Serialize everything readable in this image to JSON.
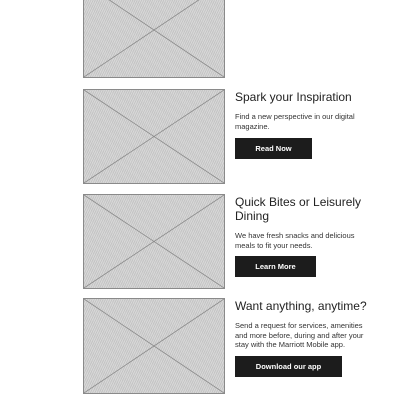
{
  "cards": [
    {
      "title": "",
      "description": "",
      "button_label": "",
      "image_icon": "image-placeholder-icon"
    },
    {
      "title": "Spark your Inspiration",
      "description": "Find a new perspective in our digital magazine.",
      "button_label": "Read Now",
      "image_icon": "image-placeholder-icon"
    },
    {
      "title": "Quick Bites or Leisurely Dining",
      "description": "We have fresh snacks and delicious meals to fit your needs.",
      "button_label": "Learn More",
      "image_icon": "image-placeholder-icon"
    },
    {
      "title": "Want anything, anytime?",
      "description": "Send a request for services, amenities and more before, during and after your stay with the Marriott Mobile app.",
      "button_label": "Download our app",
      "image_icon": "image-placeholder-icon"
    }
  ],
  "colors": {
    "button_bg": "#1c1c1c",
    "button_text": "#ffffff",
    "placeholder_fill": "#cfcfcf",
    "placeholder_border": "#8a8a8a"
  }
}
